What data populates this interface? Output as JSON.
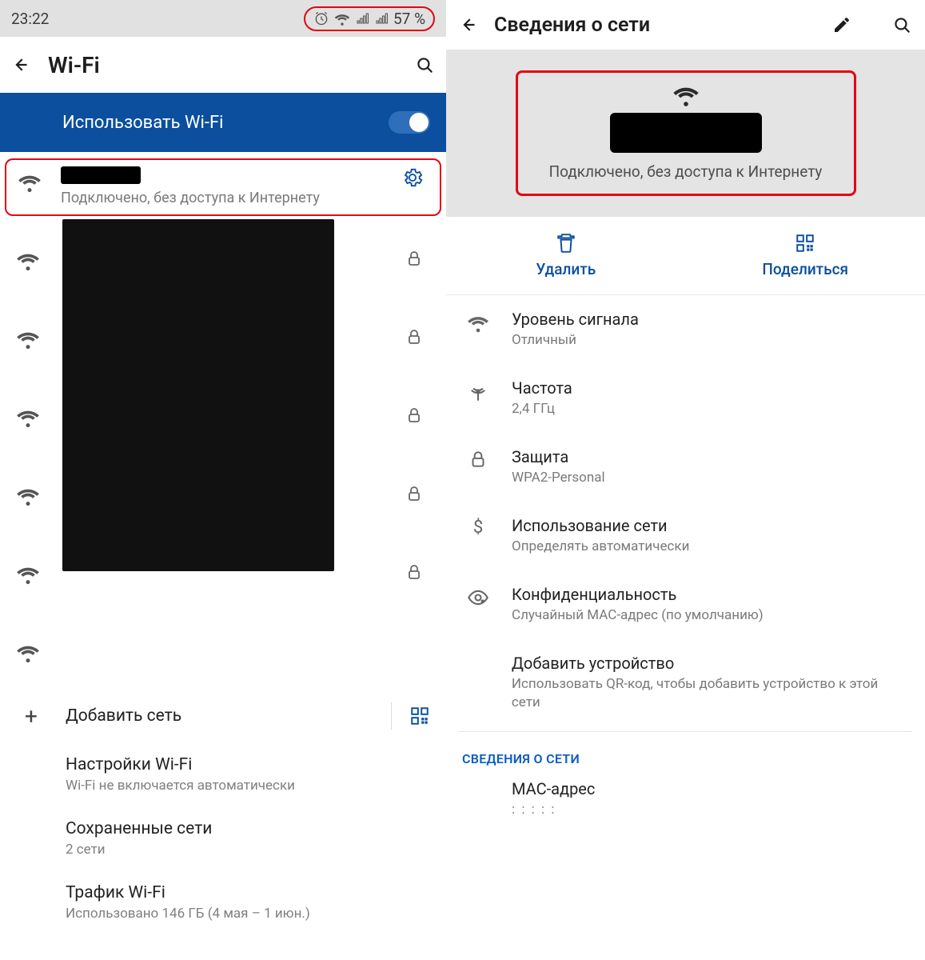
{
  "left": {
    "statusbar": {
      "time": "23:22",
      "battery": "57 %"
    },
    "appbar": {
      "title": "Wi-Fi"
    },
    "toggle": {
      "label": "Использовать Wi-Fi",
      "on": true
    },
    "connected": {
      "subtitle": "Подключено, без доступа к Интернету"
    },
    "add_network": "Добавить сеть",
    "settings": [
      {
        "title": "Настройки Wi-Fi",
        "sub": "Wi-Fi не включается автоматически"
      },
      {
        "title": "Сохраненные сети",
        "sub": "2 сети"
      },
      {
        "title": "Трафик Wi-Fi",
        "sub": "Использовано 146 ГБ (4 мая – 1 июн.)"
      }
    ]
  },
  "right": {
    "appbar": {
      "title": "Сведения о сети"
    },
    "hero_status": "Подключено, без доступа к Интернету",
    "actions": {
      "delete": "Удалить",
      "share": "Поделиться"
    },
    "details": {
      "signal_t": "Уровень сигнала",
      "signal_v": "Отличный",
      "freq_t": "Частота",
      "freq_v": "2,4 ГГц",
      "sec_t": "Защита",
      "sec_v": "WPA2-Personal",
      "usage_t": "Использование сети",
      "usage_v": "Определять автоматически",
      "priv_t": "Конфиденциальность",
      "priv_v": "Случайный MAC-адрес (по умолчанию)",
      "add_dev_t": "Добавить устройство",
      "add_dev_v": "Использовать QR-код, чтобы добавить устройство к этой сети"
    },
    "section_label": "СВЕДЕНИЯ О СЕТИ",
    "mac_t": "MAC-адрес",
    "mac_v": "  :    :    :    :    :  "
  }
}
